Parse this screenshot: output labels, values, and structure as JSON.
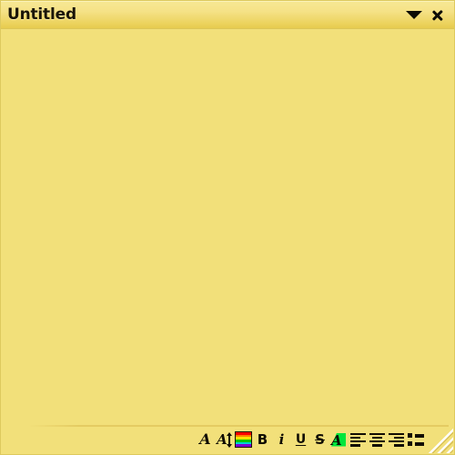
{
  "window": {
    "title": "Untitled",
    "theme": {
      "note_background": "#f2e07a",
      "titlebar_top": "#f7e894",
      "titlebar_bottom": "#e6cb4e",
      "border": "#ddc95e",
      "text": "#1a1508",
      "highlight_green": "#00e63c"
    },
    "titlebar_buttons": [
      {
        "name": "menu-dropdown-button",
        "icon": "caret-down-icon",
        "label": ""
      },
      {
        "name": "close-button",
        "icon": "close-icon",
        "label": ""
      }
    ]
  },
  "note": {
    "content": "",
    "placeholder": ""
  },
  "toolbar": {
    "items": [
      {
        "name": "font-face-button",
        "icon": "font-face-icon",
        "label": "A",
        "tooltip": "Font"
      },
      {
        "name": "font-size-button",
        "icon": "font-size-icon",
        "label": "A",
        "tooltip": "Font size"
      },
      {
        "name": "text-color-button",
        "icon": "color-palette-icon",
        "label": "",
        "tooltip": "Text color"
      },
      {
        "name": "bold-button",
        "icon": "bold-icon",
        "label": "B",
        "tooltip": "Bold"
      },
      {
        "name": "italic-button",
        "icon": "italic-icon",
        "label": "i",
        "tooltip": "Italic"
      },
      {
        "name": "underline-button",
        "icon": "underline-icon",
        "label": "U",
        "tooltip": "Underline"
      },
      {
        "name": "strikethrough-button",
        "icon": "strikethrough-icon",
        "label": "S",
        "tooltip": "Strikethrough"
      },
      {
        "name": "highlight-button",
        "icon": "highlight-icon",
        "label": "A",
        "tooltip": "Highlight"
      },
      {
        "name": "align-left-button",
        "icon": "align-left-icon",
        "label": "",
        "tooltip": "Align left"
      },
      {
        "name": "align-center-button",
        "icon": "align-center-icon",
        "label": "",
        "tooltip": "Align center"
      },
      {
        "name": "align-right-button",
        "icon": "align-right-icon",
        "label": "",
        "tooltip": "Align right"
      },
      {
        "name": "bullet-list-button",
        "icon": "bullet-list-icon",
        "label": "",
        "tooltip": "Bulleted list"
      }
    ],
    "color_swatch_stripes": [
      "#ff0000",
      "#ff7f00",
      "#ffe400",
      "#00c800",
      "#00d2d2",
      "#7a00d2"
    ]
  }
}
